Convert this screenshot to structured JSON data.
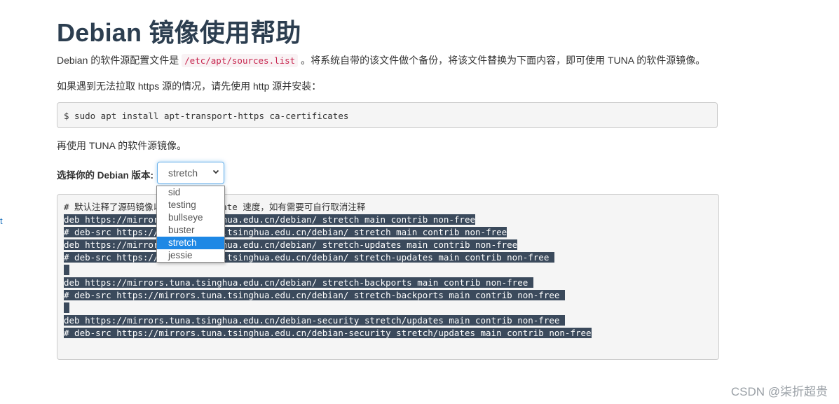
{
  "page": {
    "title": "Debian 镜像使用帮助",
    "intro_prefix": "Debian 的软件源配置文件是 ",
    "intro_code": "/etc/apt/sources.list",
    "intro_suffix": " 。将系统自带的该文件做个备份，将该文件替换为下面内容，即可使用 TUNA 的软件源镜像。",
    "https_note": "如果遇到无法拉取 https 源的情况，请先使用 http 源并安装：",
    "install_command": "$ sudo apt install apt-transport-https ca-certificates",
    "use_tuna": "再使用 TUNA 的软件源镜像。",
    "select_label": "选择你的 Debian 版本:",
    "selected_version": "stretch",
    "left_edge_char": "t",
    "watermark": "CSDN @柒折超贵"
  },
  "dropdown": {
    "options": [
      "sid",
      "testing",
      "bullseye",
      "buster",
      "stretch",
      "jessie"
    ],
    "active_index": 4
  },
  "code": {
    "lines": [
      {
        "visible": "# 默认注释了源码镜像以提高 apt update 速度，如有需要可自行取消注释",
        "selected": false
      },
      {
        "visible": "deb https://mirrors.tuna.tsinghua.edu.cn/debian/ stretch main contrib non-free",
        "selected": true
      },
      {
        "visible": "# deb-src https://mirrors.tuna.tsinghua.edu.cn/debian/ stretch main contrib non-free",
        "selected": true
      },
      {
        "visible": "deb https://mirrors.tuna.tsinghua.edu.cn/debian/ stretch-updates main contrib non-free",
        "selected": true
      },
      {
        "visible": "# deb-src https://mirrors.tuna.tsinghua.edu.cn/debian/ stretch-updates main contrib non-free ",
        "selected": true
      },
      {
        "visible": " ",
        "selected": true
      },
      {
        "visible": "deb https://mirrors.tuna.tsinghua.edu.cn/debian/ stretch-backports main contrib non-free ",
        "selected": true
      },
      {
        "visible": "# deb-src https://mirrors.tuna.tsinghua.edu.cn/debian/ stretch-backports main contrib non-free ",
        "selected": true
      },
      {
        "visible": " ",
        "selected": true
      },
      {
        "visible": "deb https://mirrors.tuna.tsinghua.edu.cn/debian-security stretch/updates main contrib non-free ",
        "selected": true
      },
      {
        "visible": "# deb-src https://mirrors.tuna.tsinghua.edu.cn/debian-security stretch/updates main contrib non-free",
        "selected": true
      }
    ]
  },
  "colors": {
    "title": "#2c3e50",
    "selection_bg": "#3b4a5c",
    "dropdown_active": "#1e88e5",
    "focus_border": "#66afe9"
  }
}
